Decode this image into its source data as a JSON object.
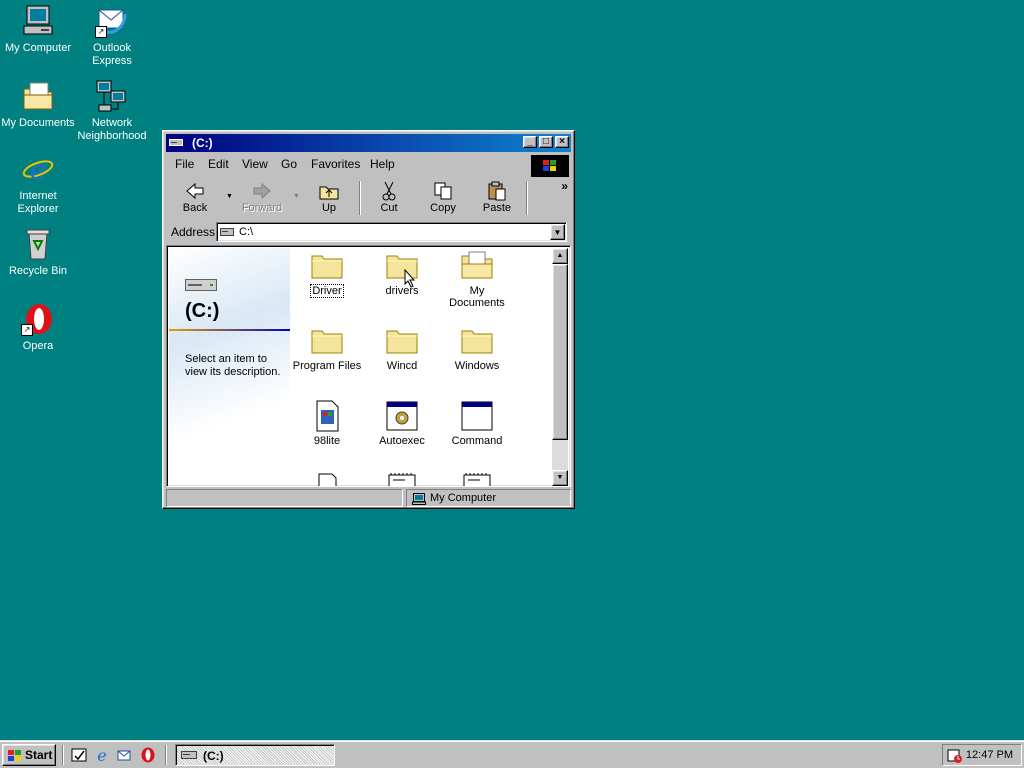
{
  "desktop": {
    "icons": [
      {
        "label": "My Computer"
      },
      {
        "label": "Outlook Express"
      },
      {
        "label": "My Documents"
      },
      {
        "label": "Network Neighborhood"
      },
      {
        "label": "Internet Explorer"
      },
      {
        "label": "Recycle Bin"
      },
      {
        "label": "Opera"
      }
    ]
  },
  "window": {
    "title": "(C:)",
    "menu": [
      "File",
      "Edit",
      "View",
      "Go",
      "Favorites",
      "Help"
    ],
    "toolbar": {
      "back": "Back",
      "forward": "Forward",
      "up": "Up",
      "cut": "Cut",
      "copy": "Copy",
      "paste": "Paste",
      "more": "»"
    },
    "address": {
      "label": "Address",
      "value": "C:\\"
    },
    "webview": {
      "drive_title": "(C:)",
      "description": "Select an item to view its description."
    },
    "files": [
      {
        "label": "Driver",
        "icon": "folder-icon"
      },
      {
        "label": "drivers",
        "icon": "folder-icon"
      },
      {
        "label": "My Documents",
        "icon": "my-documents-folder-icon"
      },
      {
        "label": "Program Files",
        "icon": "folder-icon"
      },
      {
        "label": "Wincd",
        "icon": "folder-icon"
      },
      {
        "label": "Windows",
        "icon": "folder-icon"
      },
      {
        "label": "98lite",
        "icon": "setup-file-icon"
      },
      {
        "label": "Autoexec",
        "icon": "batch-file-icon"
      },
      {
        "label": "Command",
        "icon": "msdos-program-icon"
      }
    ],
    "status": {
      "zone": "My Computer"
    }
  },
  "taskbar": {
    "start_label": "Start",
    "task_label": "(C:)",
    "clock": "12:47 PM"
  },
  "colors": {
    "desktop": "#008080",
    "titlebar_start": "#000080",
    "titlebar_end": "#1084d0",
    "chrome": "#c0c0c0",
    "folder": "#f4e49c"
  }
}
